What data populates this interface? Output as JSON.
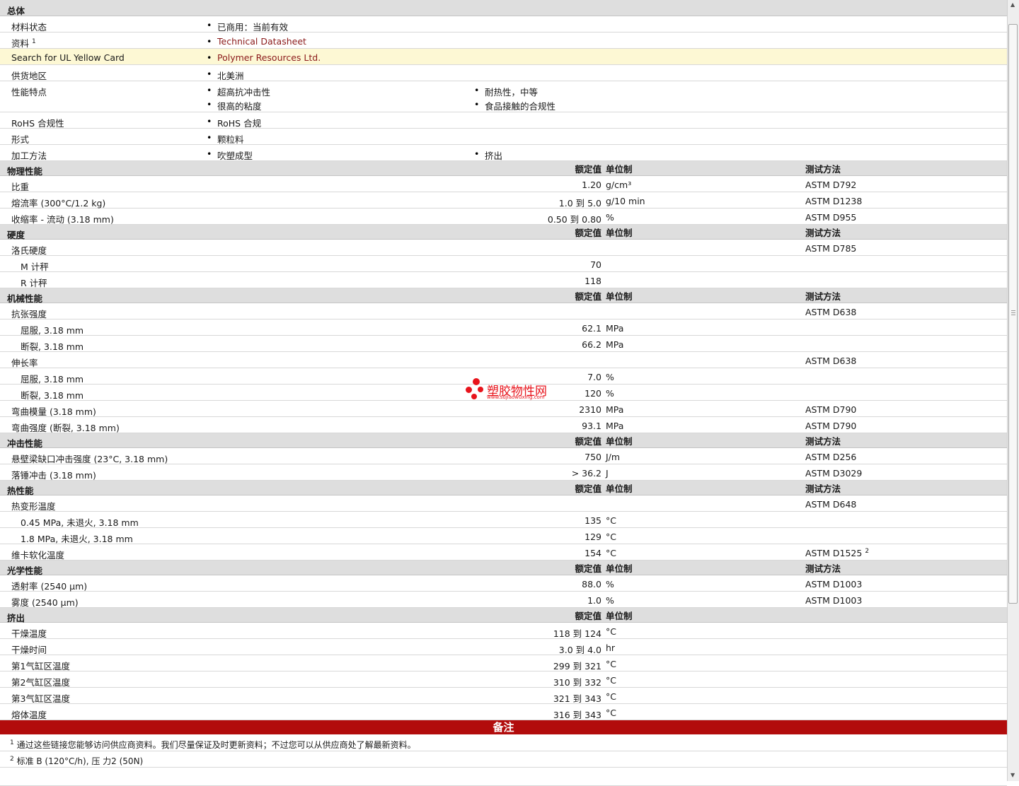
{
  "general": {
    "title": "总体",
    "rows": [
      {
        "label": "材料状态",
        "sup": "",
        "items": [
          "已商用：当前有效"
        ]
      },
      {
        "label": "资料",
        "sup": "1",
        "items": [
          "Technical Datasheet"
        ],
        "link": true
      },
      {
        "label": "Search for UL Yellow Card",
        "sup": "",
        "items": [
          "Polymer Resources Ltd."
        ],
        "link": true,
        "highlight": true
      },
      {
        "label": "供货地区",
        "sup": "",
        "items": [
          "北美洲"
        ]
      },
      {
        "label": "性能特点",
        "sup": "",
        "items": [
          "超高抗冲击性",
          "耐热性，中等",
          "很高的粘度",
          "食品接触的合规性"
        ]
      },
      {
        "label": "RoHS 合规性",
        "sup": "",
        "items": [
          "RoHS 合规"
        ]
      },
      {
        "label": "形式",
        "sup": "",
        "items": [
          "颗粒料"
        ]
      },
      {
        "label": "加工方法",
        "sup": "",
        "items": [
          "吹塑成型",
          "挤出"
        ]
      }
    ]
  },
  "column_headers": {
    "value": "额定值",
    "unit": "单位制",
    "test": "测试方法"
  },
  "sections": [
    {
      "title": "物理性能",
      "rows": [
        {
          "label": "比重",
          "value": "1.20",
          "unit": "g/cm³",
          "test": "ASTM D792"
        },
        {
          "label": "熔流率  (300°C/1.2 kg)",
          "value": "1.0 到  5.0",
          "unit": "g/10 min",
          "test": "ASTM D1238"
        },
        {
          "label": "收缩率  - 流动  (3.18 mm)",
          "value": "0.50 到  0.80",
          "unit": "%",
          "test": "ASTM D955"
        }
      ]
    },
    {
      "title": "硬度",
      "rows": [
        {
          "label": "洛氏硬度",
          "value": "",
          "unit": "",
          "test": "ASTM D785"
        },
        {
          "label": "M 计秤",
          "value": "70",
          "unit": "",
          "test": "",
          "sub": true
        },
        {
          "label": "R 计秤",
          "value": "118",
          "unit": "",
          "test": "",
          "sub": true
        }
      ]
    },
    {
      "title": "机械性能",
      "rows": [
        {
          "label": "抗张强度",
          "value": "",
          "unit": "",
          "test": "ASTM D638"
        },
        {
          "label": "屈服, 3.18 mm",
          "value": "62.1",
          "unit": "MPa",
          "test": "",
          "sub": true
        },
        {
          "label": "断裂, 3.18 mm",
          "value": "66.2",
          "unit": "MPa",
          "test": "",
          "sub": true
        },
        {
          "label": "伸长率",
          "value": "",
          "unit": "",
          "test": "ASTM D638"
        },
        {
          "label": "屈服, 3.18 mm",
          "value": "7.0",
          "unit": "%",
          "test": "",
          "sub": true
        },
        {
          "label": "断裂, 3.18 mm",
          "value": "120",
          "unit": "%",
          "test": "",
          "sub": true
        },
        {
          "label": "弯曲模量  (3.18 mm)",
          "value": "2310",
          "unit": "MPa",
          "test": "ASTM D790"
        },
        {
          "label": "弯曲强度  (断裂, 3.18 mm)",
          "value": "93.1",
          "unit": "MPa",
          "test": "ASTM D790"
        }
      ]
    },
    {
      "title": "冲击性能",
      "rows": [
        {
          "label": "悬壁梁缺口冲击强度  (23°C, 3.18 mm)",
          "value": "750",
          "unit": "J/m",
          "test": "ASTM D256"
        },
        {
          "label": "落锤冲击  (3.18 mm)",
          "value": "> 36.2",
          "unit": "J",
          "test": "ASTM D3029"
        }
      ]
    },
    {
      "title": "热性能",
      "rows": [
        {
          "label": "热变形温度",
          "value": "",
          "unit": "",
          "test": "ASTM D648"
        },
        {
          "label": "0.45 MPa, 未退火, 3.18 mm",
          "value": "135",
          "unit": "°C",
          "test": "",
          "sub": true
        },
        {
          "label": "1.8 MPa, 未退火, 3.18 mm",
          "value": "129",
          "unit": "°C",
          "test": "",
          "sub": true
        },
        {
          "label": "维卡软化温度",
          "value": "154",
          "unit": "°C",
          "test": "ASTM D1525",
          "test_sup": "2"
        }
      ]
    },
    {
      "title": "光学性能",
      "rows": [
        {
          "label": "透射率  (2540 µm)",
          "value": "88.0",
          "unit": "%",
          "test": "ASTM D1003"
        },
        {
          "label": "雾度  (2540 µm)",
          "value": "1.0",
          "unit": "%",
          "test": "ASTM D1003"
        }
      ]
    },
    {
      "title": "挤出",
      "no_test_col": true,
      "rows": [
        {
          "label": "干燥温度",
          "value": "118 到  124",
          "unit": "°C",
          "test": ""
        },
        {
          "label": "干燥时间",
          "value": "3.0 到  4.0",
          "unit": "hr",
          "test": ""
        },
        {
          "label": "第1气缸区温度",
          "value": "299 到  321",
          "unit": "°C",
          "test": ""
        },
        {
          "label": "第2气缸区温度",
          "value": "310 到  332",
          "unit": "°C",
          "test": ""
        },
        {
          "label": "第3气缸区温度",
          "value": "321 到  343",
          "unit": "°C",
          "test": ""
        },
        {
          "label": "熔体温度",
          "value": "316 到  343",
          "unit": "°C",
          "test": ""
        }
      ]
    }
  ],
  "notes": {
    "title": "备注",
    "items": [
      {
        "sup": "1",
        "text": "通过这些链接您能够访问供应商资料。我们尽量保证及时更新资料；不过您可以从供应商处了解最新资料。"
      },
      {
        "sup": "2",
        "text": "标准  B (120°C/h), 压  力2 (50N)"
      }
    ]
  },
  "watermark": {
    "name": "塑胶物性网",
    "url": "www.sujiaowuxing.com",
    "color": "#e8141c"
  },
  "colors": {
    "notes_bar": "#b20c0c",
    "link": "#8b1a1a",
    "highlight_row": "#fdf8d4",
    "header_bg": "#dedede"
  }
}
